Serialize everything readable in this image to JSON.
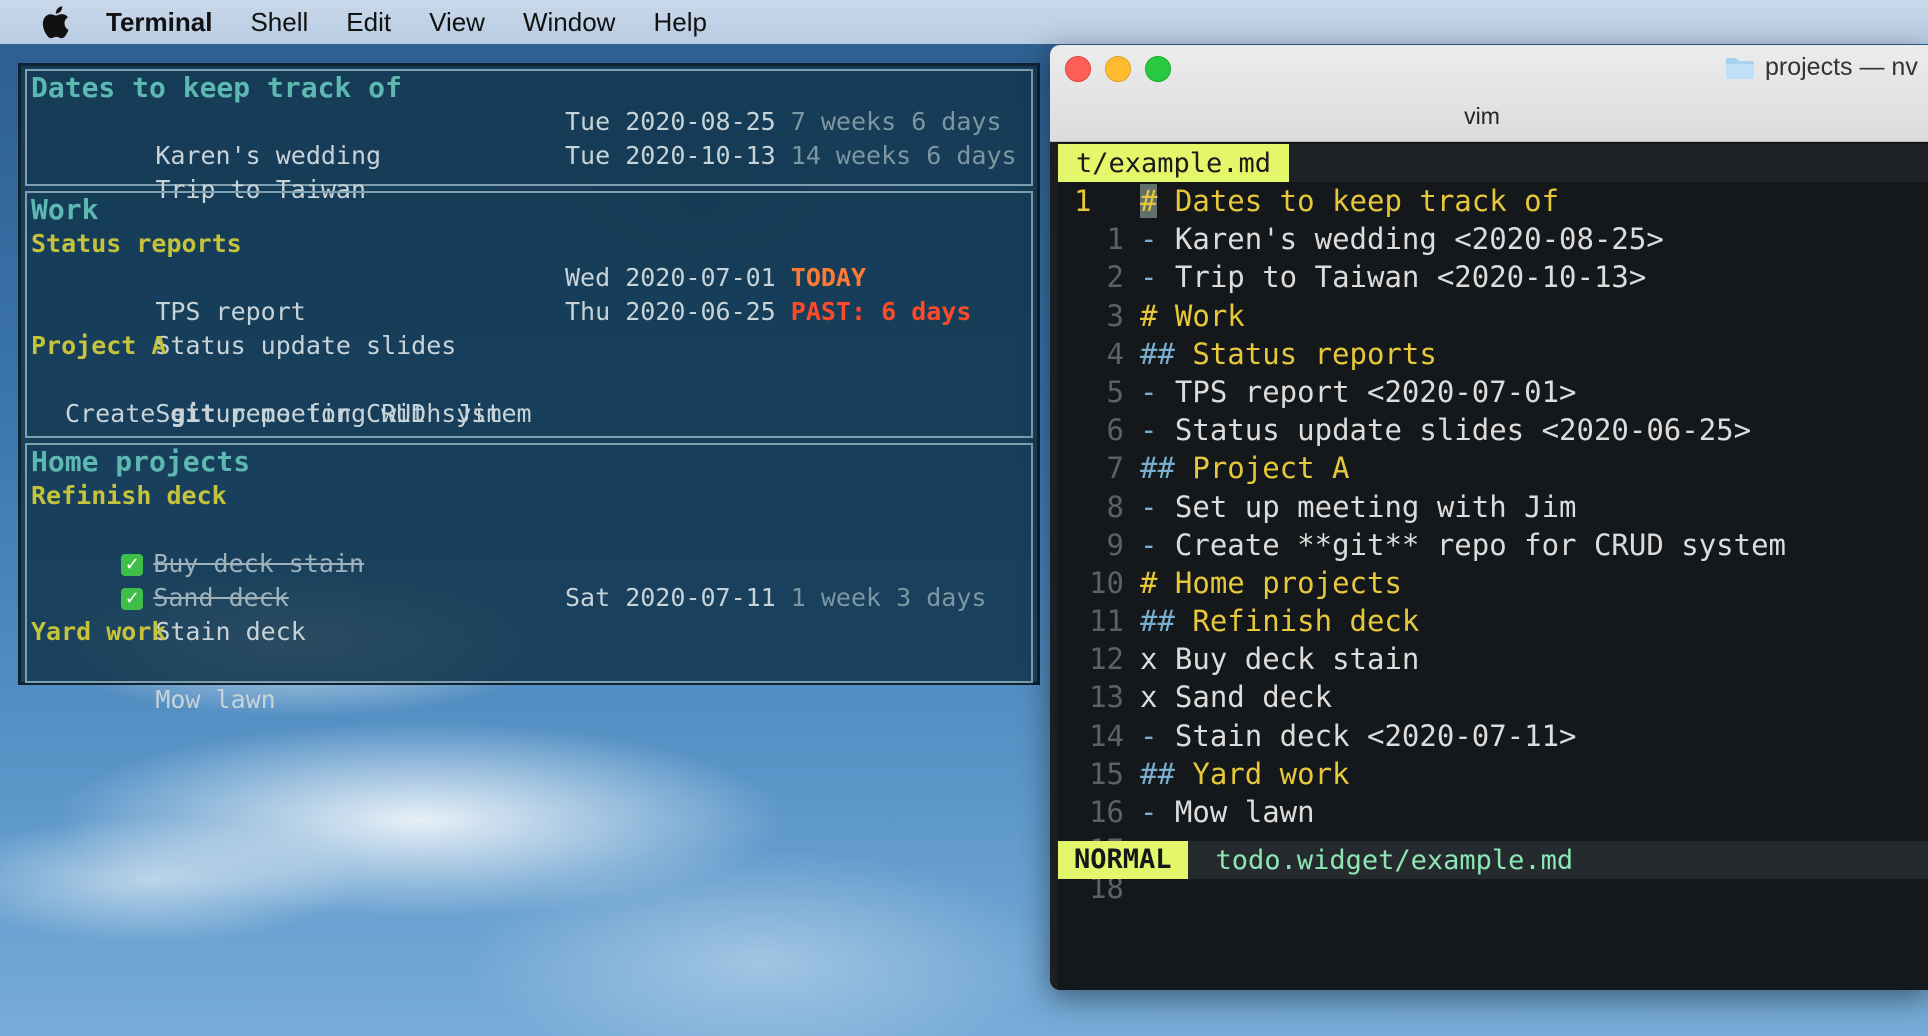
{
  "menubar": {
    "apple_icon": "apple-logo-icon",
    "app_name": "Terminal",
    "items": [
      "Shell",
      "Edit",
      "View",
      "Window",
      "Help"
    ]
  },
  "widget": {
    "sections": [
      {
        "title": "Dates to keep track of",
        "items": [
          {
            "text": "Karen's wedding",
            "date": "Tue 2020-08-25",
            "rel": "7 weeks 6 days"
          },
          {
            "text": "Trip to Taiwan",
            "date": "Tue 2020-10-13",
            "rel": "14 weeks 6 days"
          }
        ]
      },
      {
        "title": "Work",
        "sub1": "Status reports",
        "items1": [
          {
            "text": "TPS report",
            "date": "Wed 2020-07-01",
            "rel": "TODAY"
          },
          {
            "text": "Status update slides",
            "date": "Thu 2020-06-25",
            "rel": "PAST: 6 days"
          }
        ],
        "sub2": "Project A",
        "items2": [
          {
            "text": "Set up meeting with Jim"
          },
          {
            "pre": "Create ",
            "bold": "git",
            "post": " repo for CRUD system"
          }
        ]
      },
      {
        "title": "Home projects",
        "sub1": "Refinish deck",
        "items1": [
          {
            "text": "Buy deck stain",
            "done": true
          },
          {
            "text": "Sand deck",
            "done": true
          },
          {
            "text": "Stain deck",
            "date": "Sat 2020-07-11",
            "rel": "1 week 3 days"
          }
        ],
        "sub2": "Yard work",
        "items2": [
          {
            "text": "Mow lawn"
          }
        ]
      }
    ]
  },
  "terminal": {
    "window_title": "projects — nv",
    "subtitle": "vim",
    "tab": "t/example.md",
    "current_line": "1",
    "lines": [
      {
        "n": "",
        "mark": "#",
        "rest": " Dates to keep track of"
      },
      {
        "n": "1",
        "mark": "-",
        "rest": " Karen's wedding <2020-08-25>"
      },
      {
        "n": "2",
        "mark": "-",
        "rest": " Trip to Taiwan <2020-10-13>"
      },
      {
        "n": "3",
        "mark": "#",
        "rest": " Work"
      },
      {
        "n": "4",
        "mark": "##",
        "rest": " Status reports"
      },
      {
        "n": "5",
        "mark": "-",
        "rest": " TPS report <2020-07-01>"
      },
      {
        "n": "6",
        "mark": "-",
        "rest": " Status update slides <2020-06-25>"
      },
      {
        "n": "7",
        "mark": "##",
        "rest": " Project A"
      },
      {
        "n": "8",
        "mark": "-",
        "rest": " Set up meeting with Jim"
      },
      {
        "n": "9",
        "mark": "-",
        "rest": " Create **git** repo for CRUD system"
      },
      {
        "n": "10",
        "mark": "#",
        "rest": " Home projects"
      },
      {
        "n": "11",
        "mark": "##",
        "rest": " Refinish deck"
      },
      {
        "n": "12",
        "mark": "x",
        "rest": " Buy deck stain"
      },
      {
        "n": "13",
        "mark": "x",
        "rest": " Sand deck"
      },
      {
        "n": "14",
        "mark": "-",
        "rest": " Stain deck <2020-07-11>"
      },
      {
        "n": "15",
        "mark": "##",
        "rest": " Yard work"
      },
      {
        "n": "16",
        "mark": "-",
        "rest": " Mow lawn"
      },
      {
        "n": "17",
        "mark": "",
        "rest": ""
      },
      {
        "n": "18",
        "mark": "",
        "rest": ""
      }
    ],
    "mode": "NORMAL",
    "status_file": "todo.widget/example.md"
  }
}
